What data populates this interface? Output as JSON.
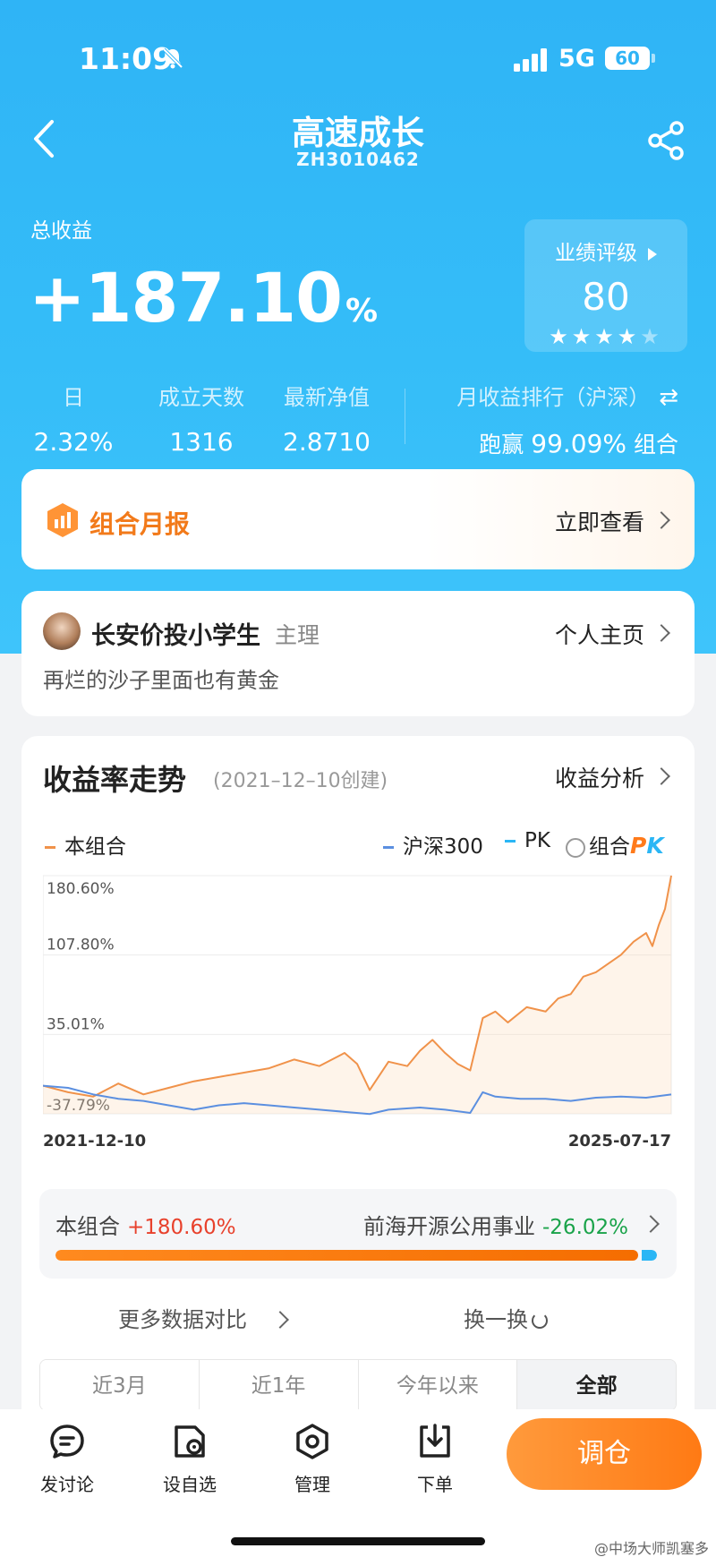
{
  "status": {
    "time": "11:09",
    "network": "5G",
    "battery": "60"
  },
  "header": {
    "title": "高速成长",
    "code": "ZH3010462"
  },
  "total": {
    "label": "总收益",
    "value": "+187.10",
    "unit": "%"
  },
  "rating": {
    "label": "业绩评级",
    "score": "80",
    "stars_on": "★★★★",
    "stars_off": "★",
    "stars_value": 4,
    "stars_max": 5
  },
  "stats": [
    {
      "label": "日",
      "value": "2.32%"
    },
    {
      "label": "成立天数",
      "value": "1316"
    },
    {
      "label": "最新净值",
      "value": "2.8710"
    }
  ],
  "rank": {
    "label": "月收益排行（沪深）",
    "swap_icon": "⇄",
    "prefix": "跑赢",
    "value": "99.09%",
    "suffix": "组合"
  },
  "report": {
    "title": "组合月报",
    "action": "立即查看"
  },
  "manager": {
    "name": "长安价投小学生",
    "role": "主理",
    "home": "个人主页",
    "motto": "再烂的沙子里面也有黄金"
  },
  "trend": {
    "title": "收益率走势",
    "created": "(2021–12–10创建)",
    "analysis": "收益分析",
    "legend": {
      "portfolio": "本组合",
      "index": "沪深300",
      "pk": "PK",
      "pk_combo": "组合",
      "pk_logo_p": "P",
      "pk_logo_k": "K"
    },
    "compare": {
      "left_label": "本组合",
      "left_value": "+180.60%",
      "right_label": "前海开源公用事业",
      "right_value": "-26.02%",
      "left_share": 0.974
    },
    "more": "更多数据对比",
    "swap": "换一换",
    "ranges": [
      "近3月",
      "近1年",
      "今年以来",
      "全部"
    ]
  },
  "chart_data": {
    "type": "line",
    "yticks": [
      "180.60%",
      "107.80%",
      "35.01%",
      "-37.79%"
    ],
    "ylim": [
      -37.79,
      180.6
    ],
    "xlabels": [
      "2021-12-10",
      "2025-07-17"
    ],
    "series": [
      {
        "name": "本组合",
        "color": "#f0924a",
        "x": [
          0,
          0.04,
          0.08,
          0.12,
          0.16,
          0.2,
          0.24,
          0.28,
          0.32,
          0.36,
          0.4,
          0.44,
          0.48,
          0.5,
          0.52,
          0.55,
          0.58,
          0.6,
          0.62,
          0.64,
          0.66,
          0.68,
          0.7,
          0.72,
          0.74,
          0.77,
          0.8,
          0.82,
          0.84,
          0.86,
          0.88,
          0.9,
          0.92,
          0.94,
          0.96,
          0.97,
          0.98,
          0.99,
          1.0
        ],
        "values": [
          -12,
          -18,
          -22,
          -10,
          -20,
          -14,
          -8,
          -4,
          0,
          4,
          12,
          6,
          18,
          8,
          -16,
          10,
          6,
          20,
          30,
          18,
          8,
          2,
          50,
          56,
          46,
          60,
          56,
          68,
          72,
          88,
          92,
          100,
          108,
          120,
          128,
          116,
          135,
          150,
          180.6
        ]
      },
      {
        "name": "沪深300",
        "color": "#5b8fe0",
        "x": [
          0,
          0.04,
          0.08,
          0.12,
          0.16,
          0.2,
          0.24,
          0.28,
          0.32,
          0.36,
          0.4,
          0.44,
          0.48,
          0.52,
          0.55,
          0.6,
          0.64,
          0.68,
          0.7,
          0.72,
          0.76,
          0.8,
          0.84,
          0.88,
          0.92,
          0.96,
          1.0
        ],
        "values": [
          -12,
          -14,
          -20,
          -24,
          -26,
          -30,
          -34,
          -30,
          -28,
          -30,
          -32,
          -34,
          -36,
          -38,
          -34,
          -32,
          -34,
          -37,
          -18,
          -22,
          -24,
          -24,
          -26,
          -23,
          -22,
          -23,
          -20
        ]
      }
    ],
    "grid": true,
    "legend": "top"
  },
  "tabs": [
    {
      "label": "发讨论",
      "icon": "discuss-icon"
    },
    {
      "label": "设自选",
      "icon": "watchlist-icon"
    },
    {
      "label": "管理",
      "icon": "manage-gear-icon"
    },
    {
      "label": "下单",
      "icon": "order-download-icon"
    }
  ],
  "cta": "调仓",
  "watermark": "@中场大师凯塞多"
}
